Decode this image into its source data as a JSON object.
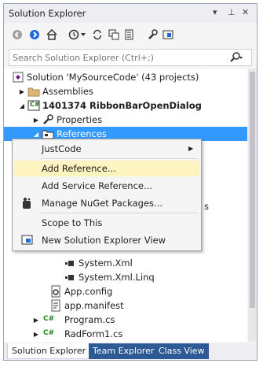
{
  "window": {
    "title": "Solution Explorer",
    "pin_glyph": "⊥",
    "close_glyph": "✕",
    "dropdown_glyph": "▾"
  },
  "search": {
    "placeholder": "Search Solution Explorer (Ctrl+;)"
  },
  "tree": {
    "solution": "Solution 'MySourceCode' (43 projects)",
    "assemblies": "Assemblies",
    "project": "1401374 RibbonBarOpenDialog",
    "properties": "Properties",
    "references": "References",
    "partial_text": "s",
    "system_xml": "System.Xml",
    "system_xml_linq": "System.Xml.Linq",
    "app_config": "App.config",
    "app_manifest": "app.manifest",
    "program_cs": "Program.cs",
    "radform_cs": "RadForm1.cs",
    "cs_badge": "C#"
  },
  "context_menu": {
    "justcode": "JustCode",
    "justcode_arrow": "▶",
    "add_reference": "Add Reference...",
    "add_service_reference": "Add Service Reference...",
    "manage_nuget": "Manage NuGet Packages...",
    "scope_to_this": "Scope to This",
    "new_view": "New Solution Explorer View"
  },
  "tabs": {
    "solution_explorer": "Solution Explorer",
    "team_explorer": "Team Explorer",
    "class_view": "Class View"
  },
  "colors": {
    "selection": "#3399ff",
    "highlight": "#fdf4bf",
    "tab_inactive": "#2d5a94"
  }
}
